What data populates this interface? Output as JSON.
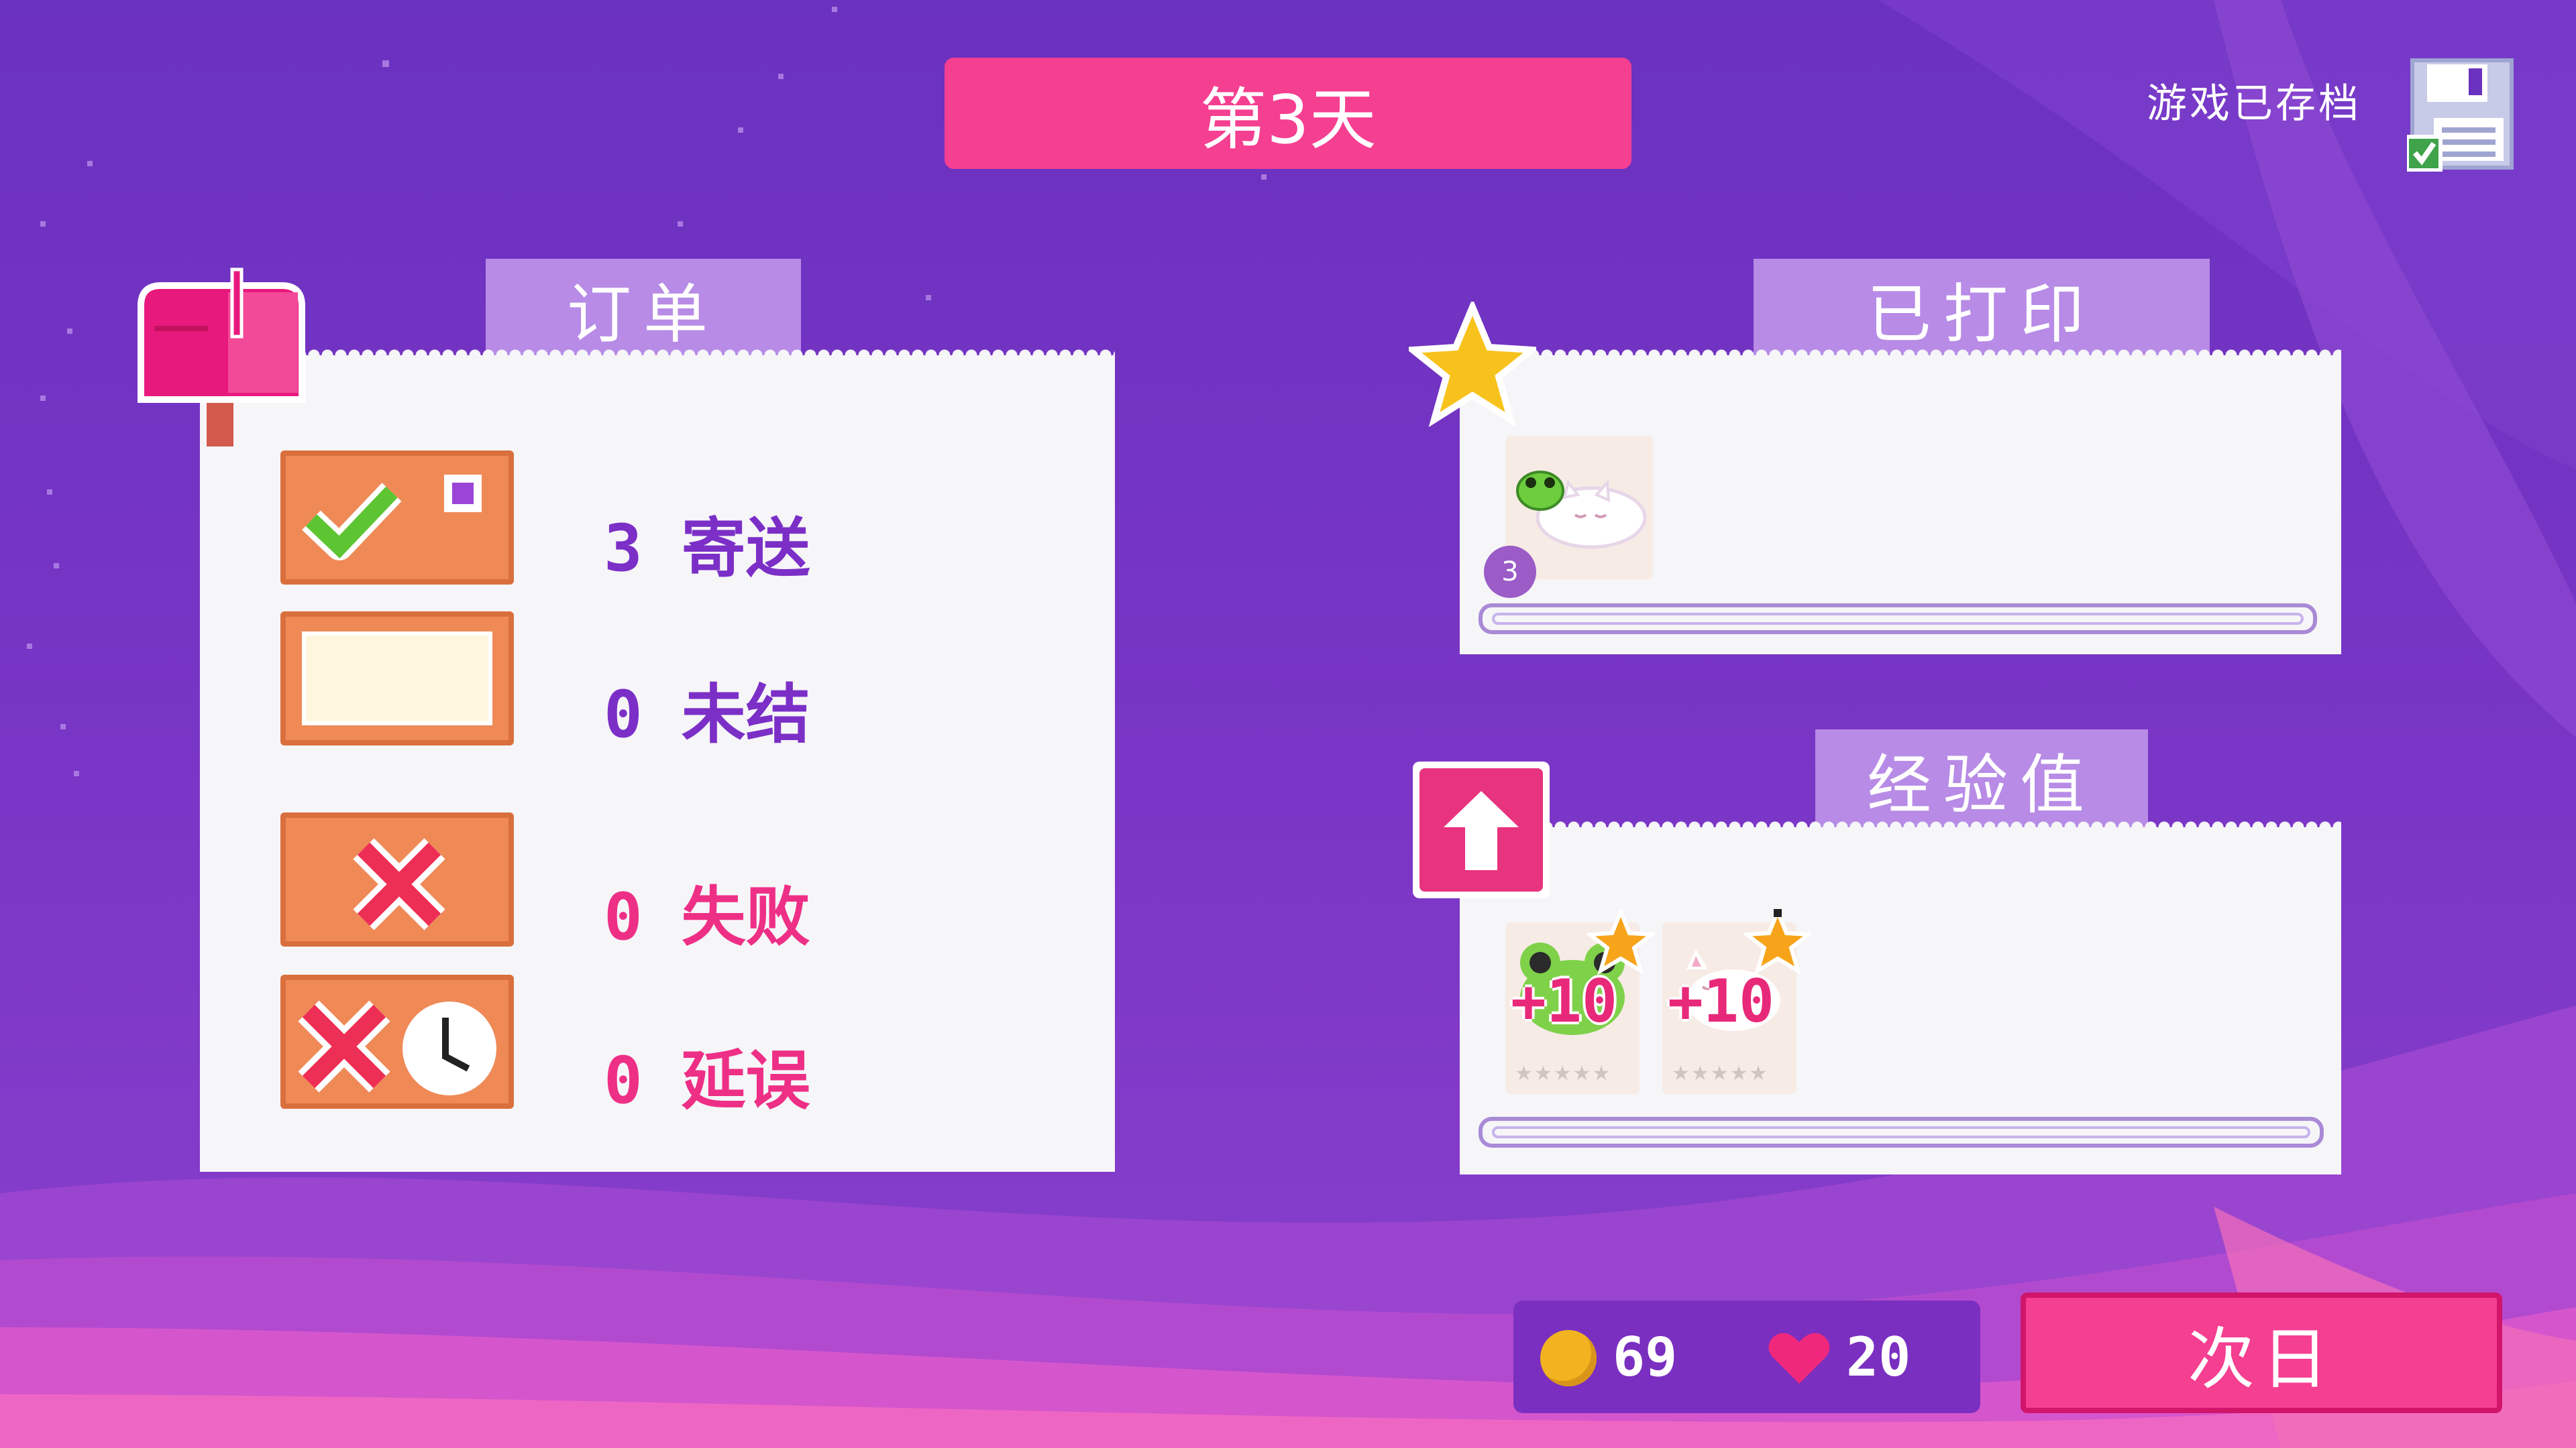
{
  "header": {
    "day_title": "第3天",
    "saved_text": "游戏已存档"
  },
  "orders_panel": {
    "title": "订单",
    "stats": [
      {
        "count": "3",
        "label": "寄送",
        "icon": "check-icon",
        "color": "#7b2fc7"
      },
      {
        "count": "0",
        "label": "未结",
        "icon": "blank-box-icon",
        "color": "#7b2fc7"
      },
      {
        "count": "0",
        "label": "失败",
        "icon": "cross-icon",
        "color": "#ee2f86"
      },
      {
        "count": "0",
        "label": "延误",
        "icon": "cross-clock-icon",
        "color": "#ee2f86"
      }
    ]
  },
  "printed_panel": {
    "title": "已打印",
    "item_count": "3"
  },
  "xp_panel": {
    "title": "经验值",
    "items": [
      {
        "name": "frog",
        "gain": "+10",
        "stars": "★★★★★"
      },
      {
        "name": "cat",
        "gain": "+10",
        "stars": "★★★★★"
      }
    ]
  },
  "footer": {
    "coins": "69",
    "hearts": "20",
    "next_day_label": "次日"
  },
  "colors": {
    "accent": "#f53f91",
    "tab": "#b78be6",
    "panel": "#f6f5f8",
    "bg_top": "#6e33c0",
    "bg_bottom": "#e65cc9"
  }
}
